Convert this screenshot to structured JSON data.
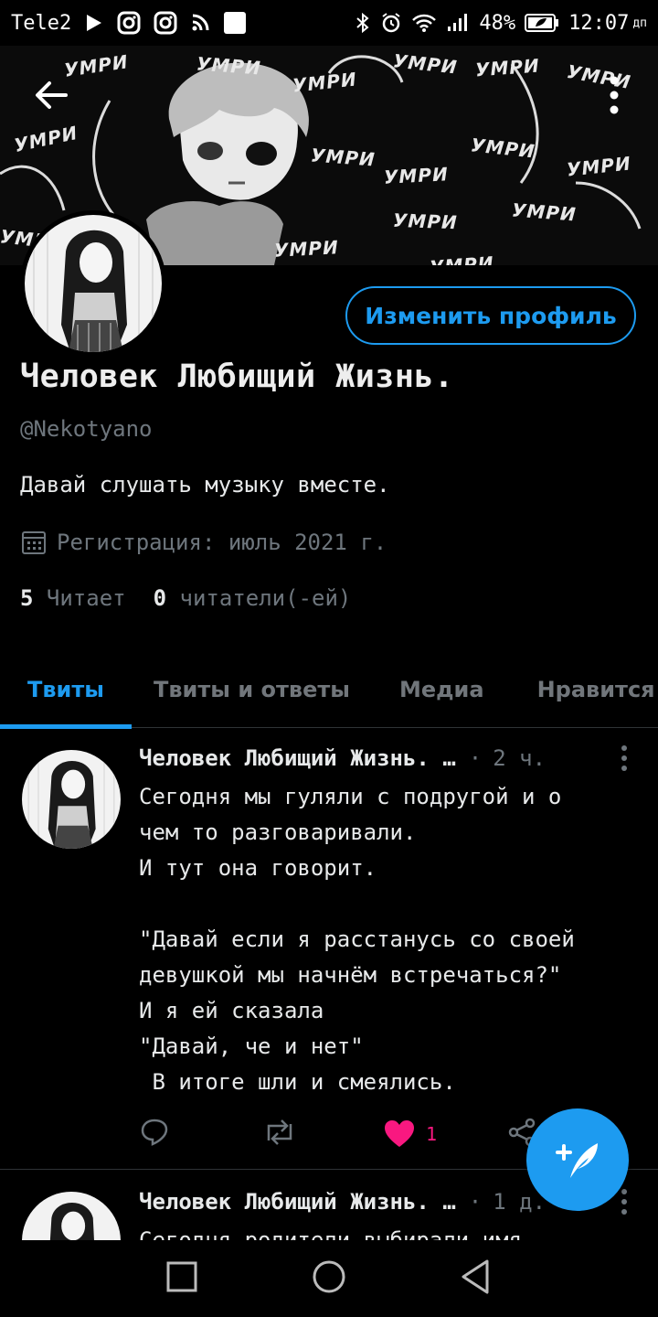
{
  "status_bar": {
    "carrier": "Tele2",
    "battery_percent": "48%",
    "time": "12:07",
    "extra": "дп"
  },
  "banner": {
    "words": [
      "УМРИ",
      "УМРИ",
      "УМРИ",
      "УМРИ",
      "УМРИ",
      "УМРИ",
      "УМРИ",
      "УМРИ",
      "УМРИ",
      "УМРИ",
      "УМРИ",
      "УМРИ",
      "УМРИ",
      "УМРИ",
      "УМРИ",
      "УМРИ"
    ]
  },
  "profile": {
    "edit_button_label": "Изменить профиль",
    "name": "Человек Любищий Жизнь.",
    "handle": "@Nekotyano",
    "bio": "Давай слушать музыку вместе.",
    "joined": "Регистрация: июль 2021 г.",
    "following_count": "5",
    "following_label": "Читает",
    "followers_count": "0",
    "followers_label": "читатели(-ей)"
  },
  "tabs": [
    {
      "label": "Твиты",
      "active": true
    },
    {
      "label": "Твиты и ответы",
      "active": false
    },
    {
      "label": "Медиа",
      "active": false
    },
    {
      "label": "Нравится",
      "active": false
    }
  ],
  "tweets": [
    {
      "name": "Человек Любищий Жизнь. …",
      "dot": "·",
      "time": "2 ч.",
      "body": "Сегодня мы гуляли с подругой и о\nчем то разговаривали.\nИ тут она говорит.\n\n\"Давай если я расстанусь со своей\nдевушкой мы начнём встречаться?\"\nИ я ей сказала\n\"Давай, че и нет\"\n В итоге шли и смеялись.",
      "likes": "1"
    },
    {
      "name": "Человек Любищий Жизнь. …",
      "dot": "·",
      "time": "1 д.",
      "body": "Сегодня родители выбирали имя"
    }
  ],
  "icons": {
    "back": "arrow-left-icon",
    "more": "more-vertical-icon",
    "calendar": "calendar-icon",
    "reply": "reply-icon",
    "retweet": "retweet-icon",
    "like": "heart-icon",
    "share": "share-icon",
    "compose": "compose-icon"
  },
  "colors": {
    "accent": "#1d9bf0",
    "like": "#f91880",
    "muted": "#6e767d"
  }
}
